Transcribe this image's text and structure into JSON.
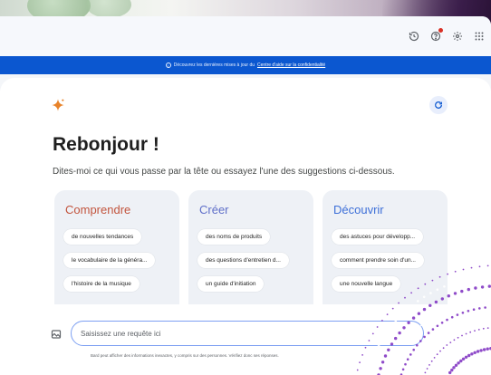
{
  "toolbar": {
    "icons": [
      "history-icon",
      "help-icon",
      "settings-icon",
      "apps-grid-icon"
    ]
  },
  "banner": {
    "text": "Découvrez les dernières mises à jour du",
    "link": "Centre d'aide sur la confidentialité"
  },
  "main": {
    "greeting": "Rebonjour !",
    "subtitle": "Dites-moi ce qui vous passe par la tête ou essayez l'une des suggestions ci-dessous."
  },
  "cards": [
    {
      "title": "Comprendre",
      "chips": [
        "de nouvelles tendances",
        "le vocabulaire de la généra...",
        "l'histoire de la musique"
      ]
    },
    {
      "title": "Créer",
      "chips": [
        "des noms de produits",
        "des questions d'entretien d...",
        "un guide d'initiation"
      ]
    },
    {
      "title": "Découvrir",
      "chips": [
        "des astuces pour développ...",
        "comment prendre soin d'un...",
        "une nouvelle langue"
      ]
    }
  ],
  "input": {
    "placeholder": "Saisissez une requête ici"
  },
  "footer": {
    "disclaimer": "Bard peut afficher des informations inexactes, y compris sur des personnes. Vérifiez donc ses réponses."
  },
  "colors": {
    "banner": "#0b57d0",
    "sparkle": "#e8832a",
    "accent": "#0b57d0",
    "swirl": "#7b2cbf"
  }
}
